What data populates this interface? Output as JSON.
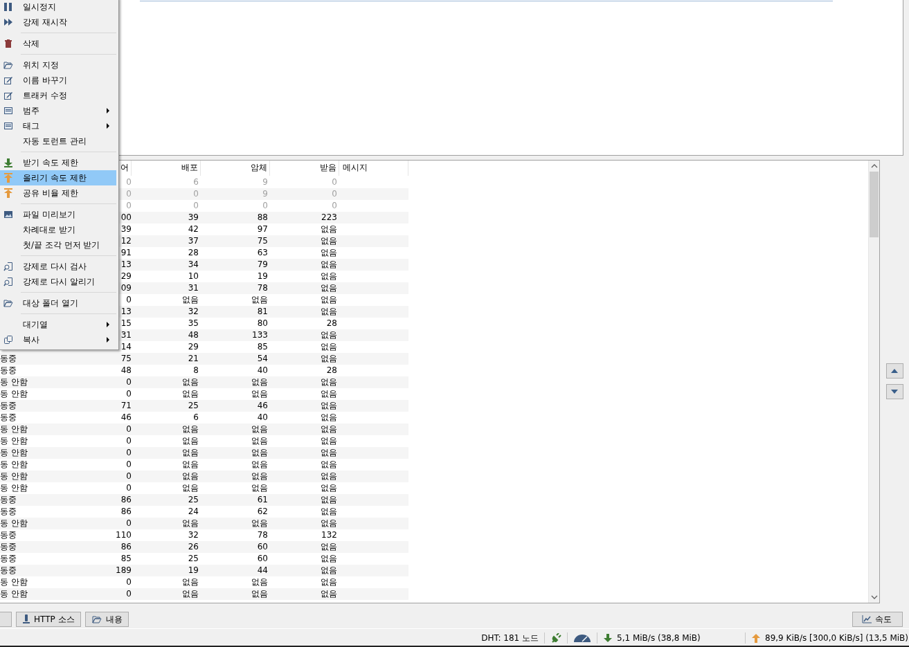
{
  "context_menu": {
    "groups": [
      [
        {
          "label": "일시정지",
          "selected": false
        },
        {
          "label": "강제 재시작",
          "selected": false
        }
      ],
      [
        {
          "label": "삭제",
          "selected": false
        }
      ],
      [
        {
          "label": "위치 지정",
          "selected": false
        },
        {
          "label": "이름 바꾸기",
          "selected": false
        },
        {
          "label": "트래커 수정",
          "selected": false
        },
        {
          "label": "범주",
          "selected": false,
          "submenu": true
        },
        {
          "label": "태그",
          "selected": false,
          "submenu": true
        },
        {
          "label": "자동 토런트 관리",
          "selected": false
        }
      ],
      [
        {
          "label": "받기 속도 제한",
          "selected": false
        },
        {
          "label": "올리기 속도 제한",
          "selected": true
        },
        {
          "label": "공유 비율 제한",
          "selected": false
        }
      ],
      [
        {
          "label": "파일 미리보기",
          "selected": false
        },
        {
          "label": "차례대로 받기",
          "selected": false
        },
        {
          "label": "첫/끝 조각 먼저 받기",
          "selected": false
        }
      ],
      [
        {
          "label": "강제로 다시 검사",
          "selected": false
        },
        {
          "label": "강제로 다시 알리기",
          "selected": false
        }
      ],
      [
        {
          "label": "대상 폴더 열기",
          "selected": false
        }
      ],
      [
        {
          "label": "대기열",
          "selected": false,
          "submenu": true
        },
        {
          "label": "복사",
          "selected": false,
          "submenu": true
        }
      ]
    ]
  },
  "table": {
    "columns": [
      "어",
      "배포",
      "암체",
      "받음",
      "메시지"
    ],
    "rows": [
      {
        "dimmed": true,
        "cells": [
          "0",
          "6",
          "9",
          "0"
        ]
      },
      {
        "dimmed": true,
        "cells": [
          "0",
          "0",
          "9",
          "0"
        ]
      },
      {
        "dimmed": true,
        "cells": [
          "0",
          "0",
          "0",
          "0"
        ]
      },
      {
        "dimmed": false,
        "cells": [
          "00",
          "39",
          "88",
          "223"
        ]
      },
      {
        "dimmed": false,
        "cells": [
          "39",
          "42",
          "97",
          "없음"
        ]
      },
      {
        "dimmed": false,
        "cells": [
          "12",
          "37",
          "75",
          "없음"
        ]
      },
      {
        "dimmed": false,
        "cells": [
          "91",
          "28",
          "63",
          "없음"
        ]
      },
      {
        "dimmed": false,
        "cells": [
          "13",
          "34",
          "79",
          "없음"
        ]
      },
      {
        "dimmed": false,
        "cells": [
          "29",
          "10",
          "19",
          "없음"
        ]
      },
      {
        "dimmed": false,
        "cells": [
          "09",
          "31",
          "78",
          "없음"
        ]
      },
      {
        "dimmed": false,
        "cells": [
          "0",
          "없음",
          "없음",
          "없음"
        ]
      },
      {
        "dimmed": false,
        "cells": [
          "13",
          "32",
          "81",
          "없음"
        ]
      },
      {
        "dimmed": false,
        "cells": [
          "15",
          "35",
          "80",
          "28"
        ]
      },
      {
        "dimmed": false,
        "cells": [
          "31",
          "48",
          "133",
          "없음"
        ]
      },
      {
        "dimmed": false,
        "cells": [
          "14",
          "29",
          "85",
          "없음"
        ]
      },
      {
        "dimmed": false,
        "status": "동중",
        "cells": [
          "75",
          "21",
          "54",
          "없음"
        ]
      },
      {
        "dimmed": false,
        "status": "동중",
        "cells": [
          "48",
          "8",
          "40",
          "28"
        ]
      },
      {
        "dimmed": false,
        "status": "동 안함",
        "cells": [
          "0",
          "없음",
          "없음",
          "없음"
        ]
      },
      {
        "dimmed": false,
        "status": "동 안함",
        "cells": [
          "0",
          "없음",
          "없음",
          "없음"
        ]
      },
      {
        "dimmed": false,
        "status": "동중",
        "cells": [
          "71",
          "25",
          "46",
          "없음"
        ]
      },
      {
        "dimmed": false,
        "status": "동중",
        "cells": [
          "46",
          "6",
          "40",
          "없음"
        ]
      },
      {
        "dimmed": false,
        "status": "동 안함",
        "cells": [
          "0",
          "없음",
          "없음",
          "없음"
        ]
      },
      {
        "dimmed": false,
        "status": "동 안함",
        "cells": [
          "0",
          "없음",
          "없음",
          "없음"
        ]
      },
      {
        "dimmed": false,
        "status": "동 안함",
        "cells": [
          "0",
          "없음",
          "없음",
          "없음"
        ]
      },
      {
        "dimmed": false,
        "status": "동 안함",
        "cells": [
          "0",
          "없음",
          "없음",
          "없음"
        ]
      },
      {
        "dimmed": false,
        "status": "동 안함",
        "cells": [
          "0",
          "없음",
          "없음",
          "없음"
        ]
      },
      {
        "dimmed": false,
        "status": "동 안함",
        "cells": [
          "0",
          "없음",
          "없음",
          "없음"
        ]
      },
      {
        "dimmed": false,
        "status": "동중",
        "cells": [
          "86",
          "25",
          "61",
          "없음"
        ]
      },
      {
        "dimmed": false,
        "status": "동중",
        "cells": [
          "86",
          "24",
          "62",
          "없음"
        ]
      },
      {
        "dimmed": false,
        "status": "동 안함",
        "cells": [
          "0",
          "없음",
          "없음",
          "없음"
        ]
      },
      {
        "dimmed": false,
        "status": "동중",
        "cells": [
          "110",
          "32",
          "78",
          "132"
        ]
      },
      {
        "dimmed": false,
        "status": "동중",
        "cells": [
          "86",
          "26",
          "60",
          "없음"
        ]
      },
      {
        "dimmed": false,
        "status": "동중",
        "cells": [
          "85",
          "25",
          "60",
          "없음"
        ]
      },
      {
        "dimmed": false,
        "status": "동중",
        "cells": [
          "189",
          "19",
          "44",
          "없음"
        ]
      },
      {
        "dimmed": false,
        "status": "동 안함",
        "cells": [
          "0",
          "없음",
          "없음",
          "없음"
        ]
      },
      {
        "dimmed": false,
        "status": "동 안함",
        "cells": [
          "0",
          "없음",
          "없음",
          "없음"
        ]
      }
    ]
  },
  "bottom_tabs": [
    "HTTP 소스",
    "내용"
  ],
  "speed_button": "속도",
  "status_bar": {
    "dht": "DHT: 181 노드",
    "download": "5,1 MiB/s (38,8 MiB)",
    "upload": "89,9 KiB/s [300,0 KiB/s] (13,5 MiB)"
  }
}
